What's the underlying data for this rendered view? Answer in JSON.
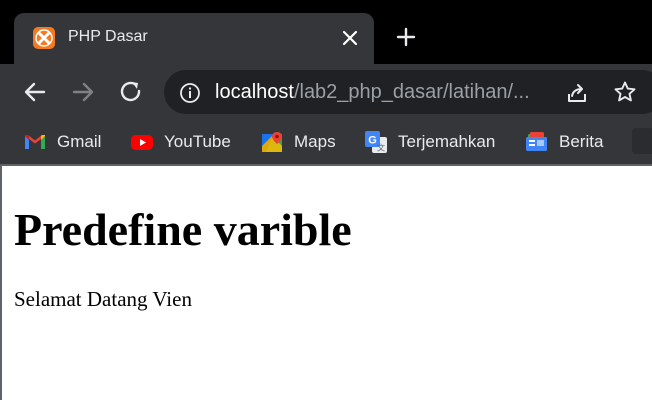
{
  "tab": {
    "title": "PHP Dasar"
  },
  "address_bar": {
    "host": "localhost",
    "path": "/lab2_php_dasar/latihan/..."
  },
  "bookmarks": [
    {
      "label": "Gmail",
      "icon": "gmail-icon"
    },
    {
      "label": "YouTube",
      "icon": "youtube-icon"
    },
    {
      "label": "Maps",
      "icon": "maps-icon"
    },
    {
      "label": "Terjemahkan",
      "icon": "translate-icon"
    },
    {
      "label": "Berita",
      "icon": "news-icon"
    }
  ],
  "page": {
    "heading": "Predefine varible",
    "paragraph": "Selamat Datang Vien"
  },
  "colors": {
    "tab_bg": "#35363a",
    "omnibox_bg": "#202124",
    "favicon": "#f37a20"
  }
}
